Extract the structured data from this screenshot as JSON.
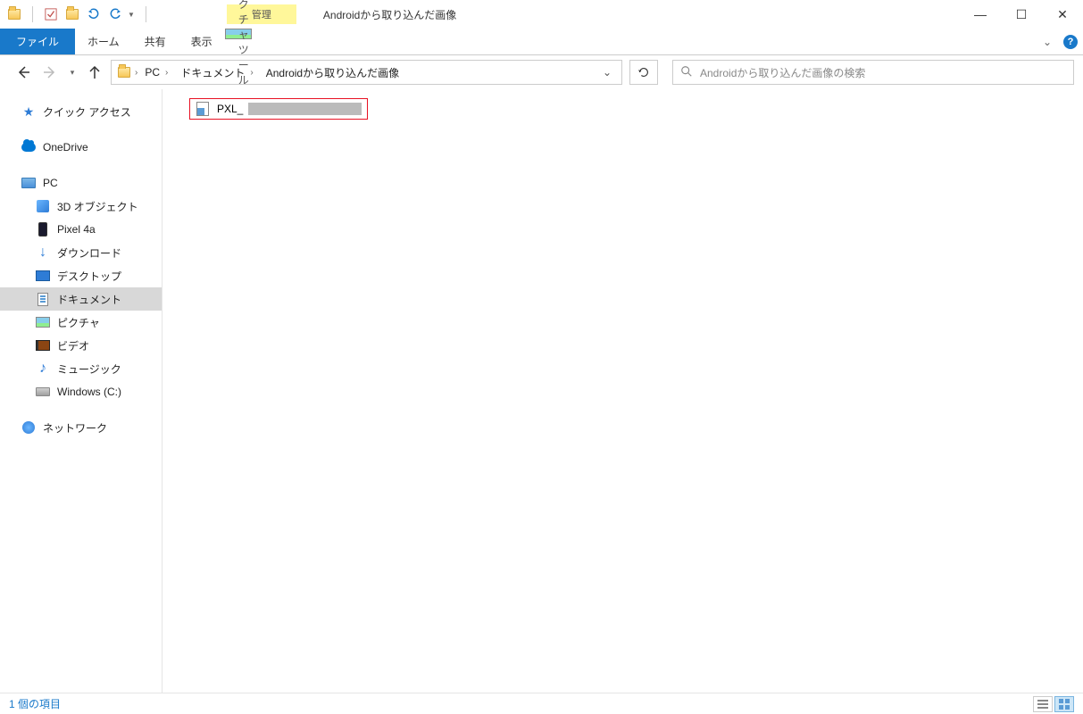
{
  "titlebar": {
    "manage_tab": "管理",
    "title": "Androidから取り込んだ画像"
  },
  "ribbon": {
    "file": "ファイル",
    "home": "ホーム",
    "share": "共有",
    "view": "表示",
    "picture_tools": "ピクチャ ツール"
  },
  "breadcrumb": {
    "pc": "PC",
    "documents": "ドキュメント",
    "current": "Androidから取り込んだ画像"
  },
  "search": {
    "placeholder": "Androidから取り込んだ画像の検索"
  },
  "sidebar": {
    "quick_access": "クイック アクセス",
    "onedrive": "OneDrive",
    "pc": "PC",
    "objects_3d": "3D オブジェクト",
    "pixel4a": "Pixel 4a",
    "downloads": "ダウンロード",
    "desktop": "デスクトップ",
    "documents": "ドキュメント",
    "pictures": "ピクチャ",
    "videos": "ビデオ",
    "music": "ミュージック",
    "windows_c": "Windows (C:)",
    "network": "ネットワーク"
  },
  "files": {
    "item1": "PXL_"
  },
  "statusbar": {
    "count": "1 個の項目"
  }
}
